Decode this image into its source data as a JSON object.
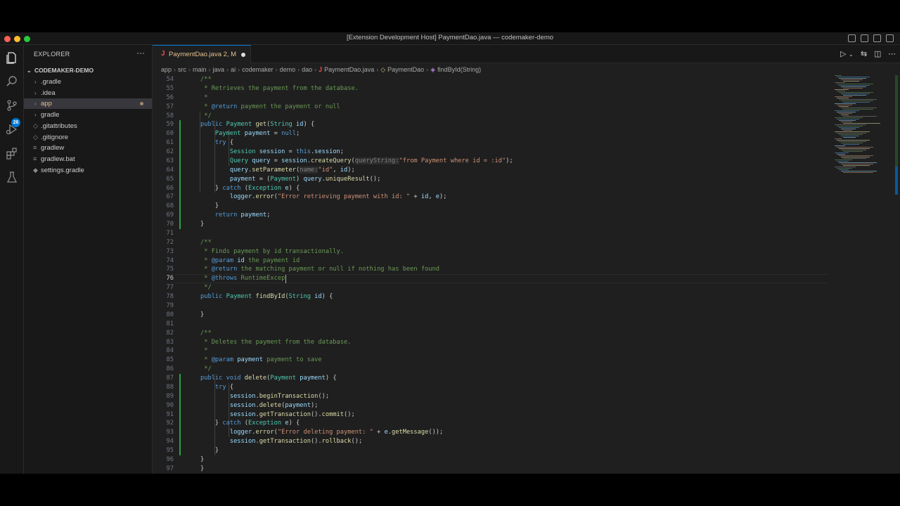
{
  "window": {
    "title": "[Extension Development Host] PaymentDao.java — codemaker-demo",
    "traffic_colors": [
      "#ff5f57",
      "#febc2e",
      "#28c840"
    ]
  },
  "activity_bar": {
    "items": [
      "files-icon",
      "search-icon",
      "source-control-icon",
      "run-debug-icon",
      "extensions-icon",
      "testing-icon"
    ],
    "scm_badge": "26"
  },
  "sidebar": {
    "header": "EXPLORER",
    "more": "···",
    "project": "CODEMAKER-DEMO",
    "items": [
      {
        "label": ".gradle",
        "type": "folder"
      },
      {
        "label": ".idea",
        "type": "folder"
      },
      {
        "label": "app",
        "type": "folder",
        "selected": true,
        "modified": true
      },
      {
        "label": "gradle",
        "type": "folder"
      },
      {
        "label": ".gitattributes",
        "type": "file"
      },
      {
        "label": ".gitignore",
        "type": "file"
      },
      {
        "label": "gradlew",
        "type": "file"
      },
      {
        "label": "gradlew.bat",
        "type": "file"
      },
      {
        "label": "settings.gradle",
        "type": "file"
      }
    ]
  },
  "editor": {
    "tab": {
      "icon": "J",
      "label": "PaymentDao.java  2, M"
    },
    "breadcrumb": [
      "app",
      "src",
      "main",
      "java",
      "ai",
      "codemaker",
      "demo",
      "dao",
      "PaymentDao.java",
      "PaymentDao",
      "findById(String)"
    ],
    "current_line": 76,
    "lines": [
      {
        "n": 54,
        "tokens": [
          [
            "cm",
            "/**"
          ]
        ]
      },
      {
        "n": 55,
        "tokens": [
          [
            "cm",
            " * Retrieves the payment from the database."
          ]
        ]
      },
      {
        "n": 56,
        "tokens": [
          [
            "cm",
            " *"
          ]
        ]
      },
      {
        "n": 57,
        "tokens": [
          [
            "cm",
            " * "
          ],
          [
            "cmk",
            "@return"
          ],
          [
            "cm",
            " payment the payment or null"
          ]
        ]
      },
      {
        "n": 58,
        "tokens": [
          [
            "cm",
            " */"
          ]
        ]
      },
      {
        "n": 59,
        "tokens": [
          [
            "kw",
            "public "
          ],
          [
            "ty",
            "Payment "
          ],
          [
            "fn",
            "get"
          ],
          [
            "",
            "("
          ],
          [
            "ty",
            "String "
          ],
          [
            "vr",
            "id"
          ],
          [
            "",
            ") {"
          ]
        ]
      },
      {
        "n": 60,
        "tokens": [
          [
            "",
            "    "
          ],
          [
            "ty",
            "Payment "
          ],
          [
            "vr",
            "payment"
          ],
          [
            "",
            " = "
          ],
          [
            "kw",
            "null"
          ],
          [
            "",
            ";"
          ]
        ]
      },
      {
        "n": 61,
        "tokens": [
          [
            "",
            "    "
          ],
          [
            "kw",
            "try"
          ],
          [
            "",
            " {"
          ]
        ]
      },
      {
        "n": 62,
        "tokens": [
          [
            "",
            "        "
          ],
          [
            "ty",
            "Session "
          ],
          [
            "vr",
            "session"
          ],
          [
            "",
            " = "
          ],
          [
            "kw",
            "this"
          ],
          [
            "",
            "."
          ],
          [
            "vr",
            "session"
          ],
          [
            "",
            ";"
          ]
        ]
      },
      {
        "n": 63,
        "tokens": [
          [
            "",
            "        "
          ],
          [
            "ty",
            "Query "
          ],
          [
            "vr",
            "query"
          ],
          [
            "",
            " = "
          ],
          [
            "vr",
            "session"
          ],
          [
            "",
            "."
          ],
          [
            "fn",
            "createQuery"
          ],
          [
            "",
            "("
          ],
          [
            "hn",
            "queryString:"
          ],
          [
            "st",
            "\"from Payment where id = :id\""
          ],
          [
            "",
            ");"
          ]
        ]
      },
      {
        "n": 64,
        "tokens": [
          [
            "",
            "        "
          ],
          [
            "vr",
            "query"
          ],
          [
            "",
            "."
          ],
          [
            "fn",
            "setParameter"
          ],
          [
            "",
            "("
          ],
          [
            "hn",
            "name:"
          ],
          [
            "st",
            "\"id\""
          ],
          [
            "",
            ", "
          ],
          [
            "vr",
            "id"
          ],
          [
            "",
            ");"
          ]
        ]
      },
      {
        "n": 65,
        "tokens": [
          [
            "",
            "        "
          ],
          [
            "vr",
            "payment"
          ],
          [
            "",
            " = ("
          ],
          [
            "ty",
            "Payment"
          ],
          [
            "",
            ") "
          ],
          [
            "vr",
            "query"
          ],
          [
            "",
            "."
          ],
          [
            "fn",
            "uniqueResult"
          ],
          [
            "",
            "();"
          ]
        ]
      },
      {
        "n": 66,
        "tokens": [
          [
            "",
            "    } "
          ],
          [
            "kw",
            "catch"
          ],
          [
            "",
            " ("
          ],
          [
            "ty",
            "Exception "
          ],
          [
            "vr",
            "e"
          ],
          [
            "",
            ") {"
          ]
        ]
      },
      {
        "n": 67,
        "tokens": [
          [
            "",
            "        "
          ],
          [
            "vr",
            "logger"
          ],
          [
            "",
            "."
          ],
          [
            "fn",
            "error"
          ],
          [
            "",
            "("
          ],
          [
            "st",
            "\"Error retrieving payment with id: \""
          ],
          [
            "",
            " + "
          ],
          [
            "vr",
            "id"
          ],
          [
            "",
            ", "
          ],
          [
            "vr",
            "e"
          ],
          [
            "",
            ");"
          ]
        ]
      },
      {
        "n": 68,
        "tokens": [
          [
            "",
            "    }"
          ]
        ]
      },
      {
        "n": 69,
        "tokens": [
          [
            "",
            "    "
          ],
          [
            "kw",
            "return "
          ],
          [
            "vr",
            "payment"
          ],
          [
            "",
            ";"
          ]
        ]
      },
      {
        "n": 70,
        "tokens": [
          [
            "",
            "}"
          ]
        ]
      },
      {
        "n": 71,
        "tokens": []
      },
      {
        "n": 72,
        "tokens": [
          [
            "cm",
            "/**"
          ]
        ]
      },
      {
        "n": 73,
        "tokens": [
          [
            "cm",
            " * Finds payment by id transactionally."
          ]
        ]
      },
      {
        "n": 74,
        "tokens": [
          [
            "cm",
            " * "
          ],
          [
            "cmk",
            "@param "
          ],
          [
            "vr",
            "id"
          ],
          [
            "cm",
            " the payment id"
          ]
        ]
      },
      {
        "n": 75,
        "tokens": [
          [
            "cm",
            " * "
          ],
          [
            "cmk",
            "@return"
          ],
          [
            "cm",
            " the matching payment or null if nothing has been found"
          ]
        ]
      },
      {
        "n": 76,
        "tokens": [
          [
            "cm",
            " * "
          ],
          [
            "cmk",
            "@throws"
          ],
          [
            "cm",
            " RuntimeExcep"
          ]
        ]
      },
      {
        "n": 77,
        "tokens": [
          [
            "cm",
            " */"
          ]
        ]
      },
      {
        "n": 78,
        "tokens": [
          [
            "kw",
            "public "
          ],
          [
            "ty",
            "Payment "
          ],
          [
            "fn",
            "findById"
          ],
          [
            "",
            "("
          ],
          [
            "ty",
            "String "
          ],
          [
            "vr",
            "id"
          ],
          [
            "",
            ") {"
          ]
        ]
      },
      {
        "n": 79,
        "tokens": []
      },
      {
        "n": 80,
        "tokens": [
          [
            "",
            "}"
          ]
        ]
      },
      {
        "n": 81,
        "tokens": []
      },
      {
        "n": 82,
        "tokens": [
          [
            "cm",
            "/**"
          ]
        ]
      },
      {
        "n": 83,
        "tokens": [
          [
            "cm",
            " * Deletes the payment from the database."
          ]
        ]
      },
      {
        "n": 84,
        "tokens": [
          [
            "cm",
            " *"
          ]
        ]
      },
      {
        "n": 85,
        "tokens": [
          [
            "cm",
            " * "
          ],
          [
            "cmk",
            "@param "
          ],
          [
            "vr",
            "payment"
          ],
          [
            "cm",
            " payment to save"
          ]
        ]
      },
      {
        "n": 86,
        "tokens": [
          [
            "cm",
            " */"
          ]
        ]
      },
      {
        "n": 87,
        "tokens": [
          [
            "kw",
            "public void "
          ],
          [
            "fn",
            "delete"
          ],
          [
            "",
            "("
          ],
          [
            "ty",
            "Payment "
          ],
          [
            "vr",
            "payment"
          ],
          [
            "",
            ") {"
          ]
        ]
      },
      {
        "n": 88,
        "tokens": [
          [
            "",
            "    "
          ],
          [
            "kw",
            "try"
          ],
          [
            "",
            " {"
          ]
        ]
      },
      {
        "n": 89,
        "tokens": [
          [
            "",
            "        "
          ],
          [
            "vr",
            "session"
          ],
          [
            "",
            "."
          ],
          [
            "fn",
            "beginTransaction"
          ],
          [
            "",
            "();"
          ]
        ]
      },
      {
        "n": 90,
        "tokens": [
          [
            "",
            "        "
          ],
          [
            "vr",
            "session"
          ],
          [
            "",
            "."
          ],
          [
            "fn",
            "delete"
          ],
          [
            "",
            "("
          ],
          [
            "vr",
            "payment"
          ],
          [
            "",
            ");"
          ]
        ]
      },
      {
        "n": 91,
        "tokens": [
          [
            "",
            "        "
          ],
          [
            "vr",
            "session"
          ],
          [
            "",
            "."
          ],
          [
            "fn",
            "getTransaction"
          ],
          [
            "",
            "()."
          ],
          [
            "fn",
            "commit"
          ],
          [
            "",
            "();"
          ]
        ]
      },
      {
        "n": 92,
        "tokens": [
          [
            "",
            "    } "
          ],
          [
            "kw",
            "catch"
          ],
          [
            "",
            " ("
          ],
          [
            "ty",
            "Exception "
          ],
          [
            "vr",
            "e"
          ],
          [
            "",
            ") {"
          ]
        ]
      },
      {
        "n": 93,
        "tokens": [
          [
            "",
            "        "
          ],
          [
            "vr",
            "logger"
          ],
          [
            "",
            "."
          ],
          [
            "fn",
            "error"
          ],
          [
            "",
            "("
          ],
          [
            "st",
            "\"Error deleting payment: \""
          ],
          [
            "",
            " + "
          ],
          [
            "vr",
            "e"
          ],
          [
            "",
            "."
          ],
          [
            "fn",
            "getMessage"
          ],
          [
            "",
            "());"
          ]
        ]
      },
      {
        "n": 94,
        "tokens": [
          [
            "",
            "        "
          ],
          [
            "vr",
            "session"
          ],
          [
            "",
            "."
          ],
          [
            "fn",
            "getTransaction"
          ],
          [
            "",
            "()."
          ],
          [
            "fn",
            "rollback"
          ],
          [
            "",
            "();"
          ]
        ]
      },
      {
        "n": 95,
        "tokens": [
          [
            "",
            "    }"
          ]
        ]
      },
      {
        "n": 96,
        "tokens": [
          [
            "",
            "}"
          ]
        ]
      },
      {
        "n": 97,
        "tokens": [
          [
            "",
            "}"
          ]
        ]
      },
      {
        "n": 98,
        "tokens": []
      }
    ],
    "modified_lines": [
      59,
      60,
      61,
      62,
      63,
      64,
      65,
      66,
      67,
      68,
      69,
      70,
      87,
      88,
      89,
      90,
      91,
      92,
      93,
      94,
      95
    ]
  }
}
